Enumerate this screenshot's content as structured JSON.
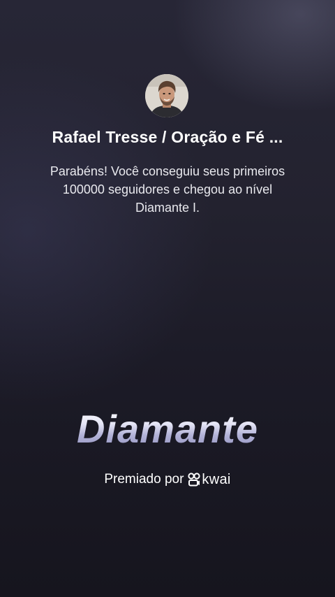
{
  "profile": {
    "name": "Rafael Tresse / Oração e Fé ..."
  },
  "achievement": {
    "message": "Parabéns! Você conseguiu seus primeiros 100000 seguidores e chegou ao nível Diamante I.",
    "level_title": "Diamante"
  },
  "footer": {
    "awarded_by_label": "Premiado por",
    "brand": "kwai"
  },
  "icons": {
    "avatar": "user-avatar",
    "brand_logo": "kwai-logo-icon"
  }
}
